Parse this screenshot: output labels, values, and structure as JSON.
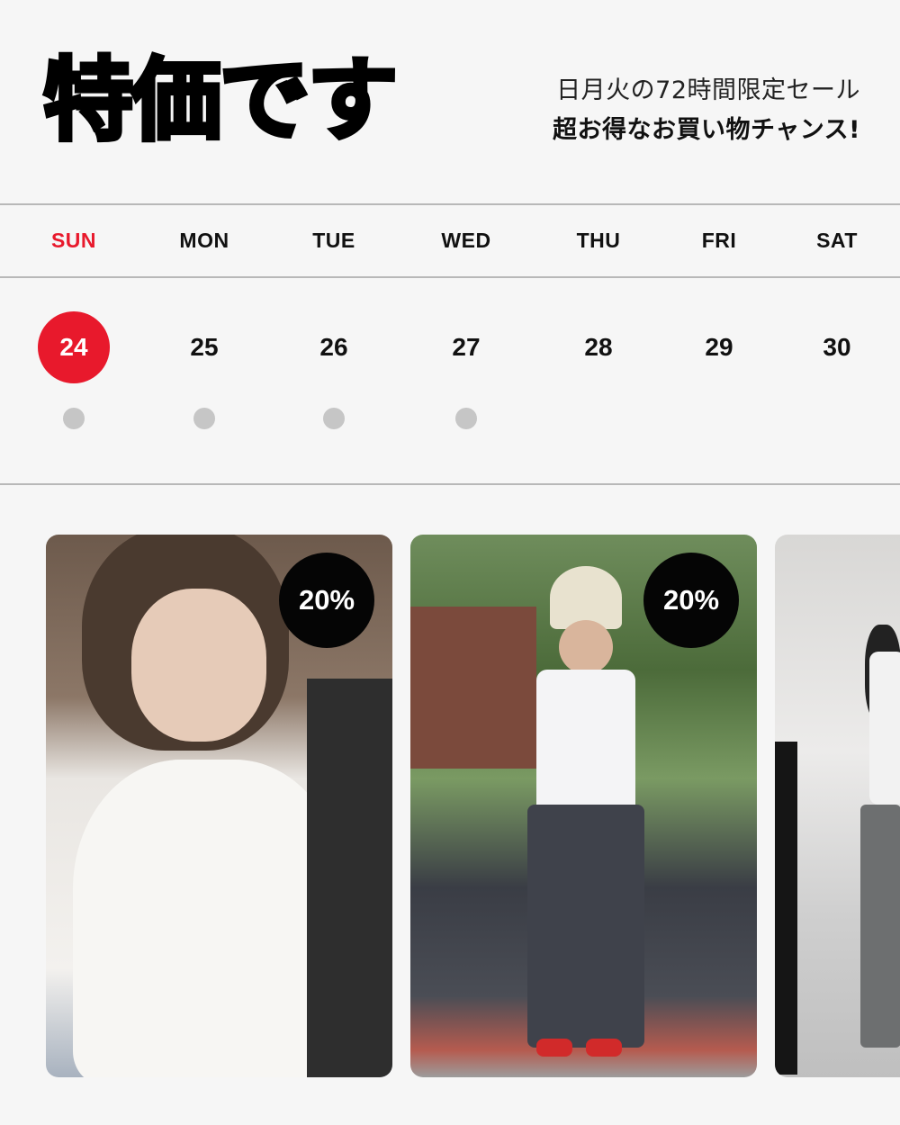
{
  "header": {
    "headline": "特価です",
    "subline_1": "日月火の72時間限定セール",
    "subline_2": "超お得なお買い物チャンス!"
  },
  "calendar": {
    "days": [
      "SUN",
      "MON",
      "TUE",
      "WED",
      "THU",
      "FRI",
      "SAT"
    ],
    "dates": [
      "24",
      "25",
      "26",
      "27",
      "28",
      "29",
      "30"
    ],
    "active_index": 0,
    "sale_day_count": 4,
    "accent_color": "#e8192c",
    "dot_color": "#c6c6c6"
  },
  "products": [
    {
      "discount": "20%"
    },
    {
      "discount": "20%"
    },
    {
      "discount": ""
    }
  ]
}
